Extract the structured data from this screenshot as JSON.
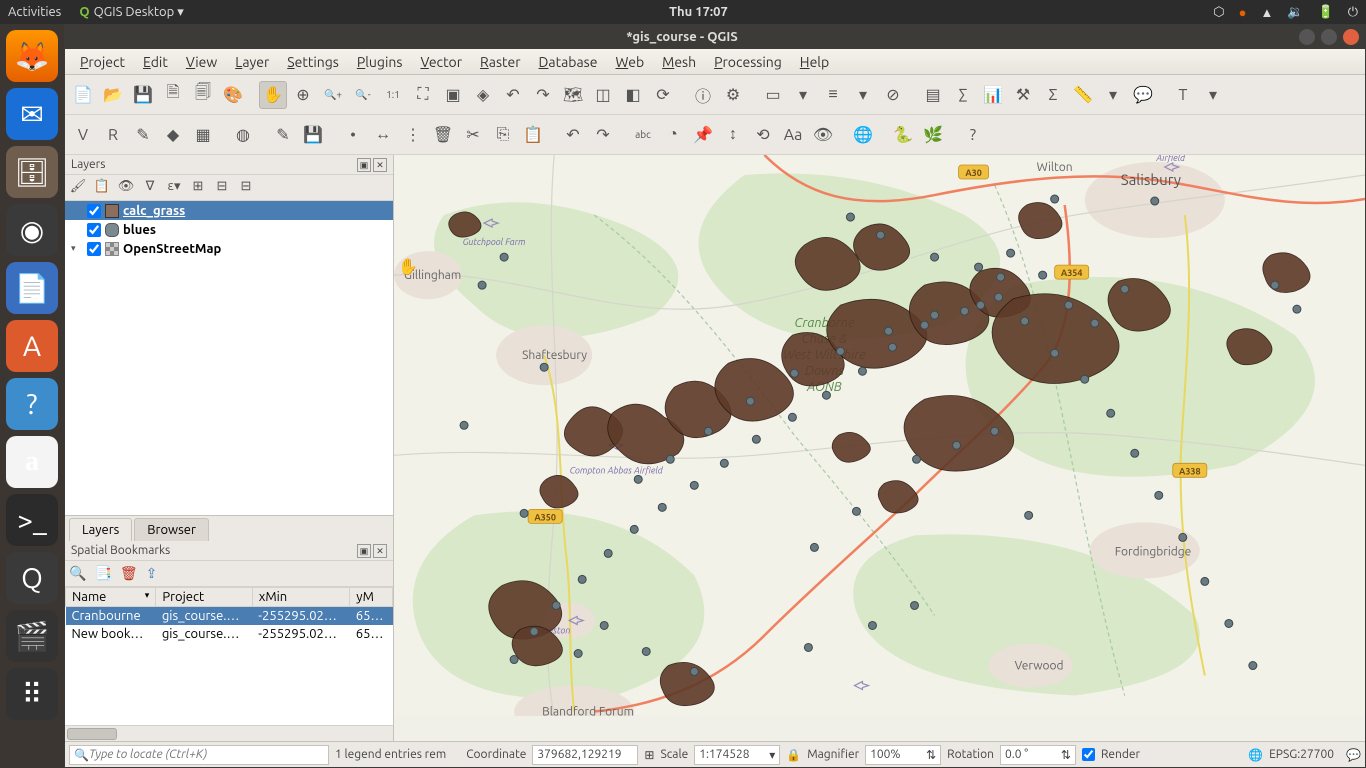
{
  "gnome": {
    "activities": "Activities",
    "app": "QGIS Desktop ▾",
    "clock": "Thu 17:07",
    "tray_icons": [
      "dropbox-icon",
      "orange-dot-icon",
      "wifi-icon",
      "volume-icon",
      "battery-icon",
      "power-icon"
    ]
  },
  "launcher": [
    {
      "name": "firefox",
      "cls": "ic-ff",
      "glyph": "🦊"
    },
    {
      "name": "thunderbird",
      "cls": "ic-tb",
      "glyph": "✉"
    },
    {
      "name": "files",
      "cls": "ic-files",
      "glyph": "🗄"
    },
    {
      "name": "media",
      "cls": "ic-mp",
      "glyph": "◉"
    },
    {
      "name": "writer",
      "cls": "ic-doc",
      "glyph": "📄"
    },
    {
      "name": "software",
      "cls": "ic-sw",
      "glyph": "A"
    },
    {
      "name": "help",
      "cls": "ic-help",
      "glyph": "?"
    },
    {
      "name": "amazon",
      "cls": "ic-amz",
      "glyph": "a"
    },
    {
      "name": "terminal",
      "cls": "ic-term",
      "glyph": ">_"
    },
    {
      "name": "qgis",
      "cls": "ic-qgis",
      "glyph": "Q"
    },
    {
      "name": "video",
      "cls": "ic-vid",
      "glyph": "🎬"
    },
    {
      "name": "apps",
      "cls": "ic-apps",
      "glyph": "⠿"
    }
  ],
  "window": {
    "title": "*gis_course - QGIS"
  },
  "menubar": [
    "Project",
    "Edit",
    "View",
    "Layer",
    "Settings",
    "Plugins",
    "Vector",
    "Raster",
    "Database",
    "Web",
    "Mesh",
    "Processing",
    "Help"
  ],
  "tb1": [
    "new-project",
    "open-project",
    "save-project",
    "new-print-layout",
    "layout-manager",
    "style-manager",
    "sep",
    "pan",
    "pan-to-selection",
    "zoom-in",
    "zoom-out",
    "zoom-native",
    "zoom-full",
    "zoom-selection",
    "zoom-layer",
    "zoom-last",
    "zoom-next",
    "new-map-view",
    "new-3d-view",
    "pan-sel",
    "refresh",
    "sep",
    "identify",
    "action",
    "sep",
    "select-features",
    "dd",
    "select-by-value",
    "dd",
    "deselect",
    "sep",
    "open-attr-table",
    "field-calc",
    "stats",
    "toolbox",
    "sum",
    "measure",
    "dd",
    "map-tips",
    "sep",
    "text-annotation",
    "dd"
  ],
  "tb2": [
    "add-vector",
    "add-raster",
    "new-shp",
    "new-spatialite",
    "new-gpkg",
    "sep",
    "virtual-layer",
    "sep",
    "toggle-edit",
    "save-edits",
    "sep",
    "add-feature",
    "move-feature",
    "node-tool",
    "delete",
    "cut",
    "copy",
    "paste",
    "sep",
    "undo",
    "redo",
    "sep",
    "label-tool",
    "label-diag",
    "label-pin",
    "label-move",
    "label-rotate",
    "label-change",
    "label-show",
    "sep",
    "osm-download",
    "sep",
    "python",
    "grass",
    "sep",
    "help-btn"
  ],
  "layers": {
    "title": "Layers",
    "tab_layers": "Layers",
    "tab_browser": "Browser",
    "items": [
      {
        "name": "calc_grass",
        "swatch": "sw-poly",
        "checked": true,
        "selected": true,
        "exp": ""
      },
      {
        "name": "blues",
        "swatch": "sw-point",
        "checked": true,
        "selected": false,
        "exp": ""
      },
      {
        "name": "OpenStreetMap",
        "swatch": "sw-raster",
        "checked": true,
        "selected": false,
        "exp": "▾"
      }
    ]
  },
  "bookmarks": {
    "title": "Spatial Bookmarks",
    "cols": [
      "Name",
      "Project",
      "xMin",
      "yM"
    ],
    "rows": [
      {
        "name": "Cranbourne",
        "project": "gis_course.…",
        "xmin": "-255295.02…",
        "ym": "65…",
        "sel": true
      },
      {
        "name": "New book…",
        "project": "gis_course.…",
        "xmin": "-255295.02…",
        "ym": "65…",
        "sel": false
      }
    ]
  },
  "status": {
    "locator_ph": "Type to locate (Ctrl+K)",
    "legend_msg": "1 legend entries rem",
    "coord_label": "Coordinate",
    "coord_value": "379682,129219",
    "scale_label": "Scale",
    "scale_value": "1:174528",
    "mag_label": "Magnifier",
    "mag_value": "100%",
    "rot_label": "Rotation",
    "rot_value": "0.0 °",
    "render_label": "Render",
    "crs": "EPSG:27700"
  },
  "map": {
    "roads": [
      "A30",
      "A354",
      "A350",
      "A338"
    ],
    "towns_big": [
      "Salisbury"
    ],
    "towns": [
      "Wilton",
      "Gillingham",
      "Shaftesbury",
      "Fordingbridge",
      "Verwood",
      "Blandford Forum",
      "Ronston"
    ],
    "poi": [
      "Gutchpool Farm",
      "Compton Abbas Airfield",
      "Airfield"
    ],
    "aonb": [
      "Cranborne",
      "Chase &",
      "West Wiltshire",
      "Downs",
      "AONB"
    ]
  }
}
